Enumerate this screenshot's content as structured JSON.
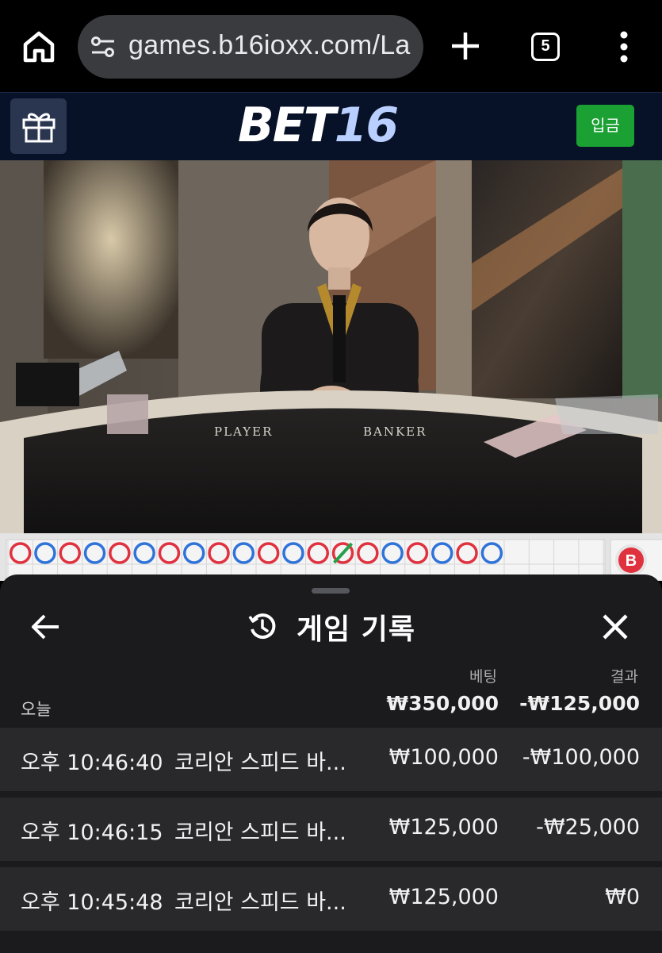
{
  "browser": {
    "url": "games.b16ioxx.com/La",
    "tab_count": "5"
  },
  "site": {
    "logo_part1": "BET",
    "logo_part2": "16",
    "deposit_label": "입금"
  },
  "video": {
    "table_label_player": "PLAYER",
    "table_label_banker": "BANKER"
  },
  "roadmap": {
    "top_row": [
      "banker",
      "player",
      "banker",
      "player",
      "banker",
      "player",
      "banker",
      "player",
      "banker",
      "player",
      "banker",
      "player",
      "banker",
      "tie",
      "banker",
      "player",
      "banker",
      "player",
      "banker",
      "player"
    ],
    "side_badge": "B"
  },
  "history": {
    "title": "게임 기록",
    "col_bet": "베팅",
    "col_result": "결과",
    "today_label": "오늘",
    "total_bet": "₩350,000",
    "total_result": "-₩125,000",
    "rows": [
      {
        "time": "오후 10:46:40",
        "game": "코리안 스피드 바...",
        "bet": "₩100,000",
        "result": "-₩100,000"
      },
      {
        "time": "오후 10:46:15",
        "game": "코리안 스피드 바...",
        "bet": "₩125,000",
        "result": "-₩25,000"
      },
      {
        "time": "오후 10:45:48",
        "game": "코리안 스피드 바...",
        "bet": "₩125,000",
        "result": "₩0"
      }
    ]
  },
  "colors": {
    "banker": "#e0313f",
    "player": "#2f73d9",
    "tie": "#22a04b",
    "deposit": "#1aa033",
    "header_bg": "#071127"
  }
}
